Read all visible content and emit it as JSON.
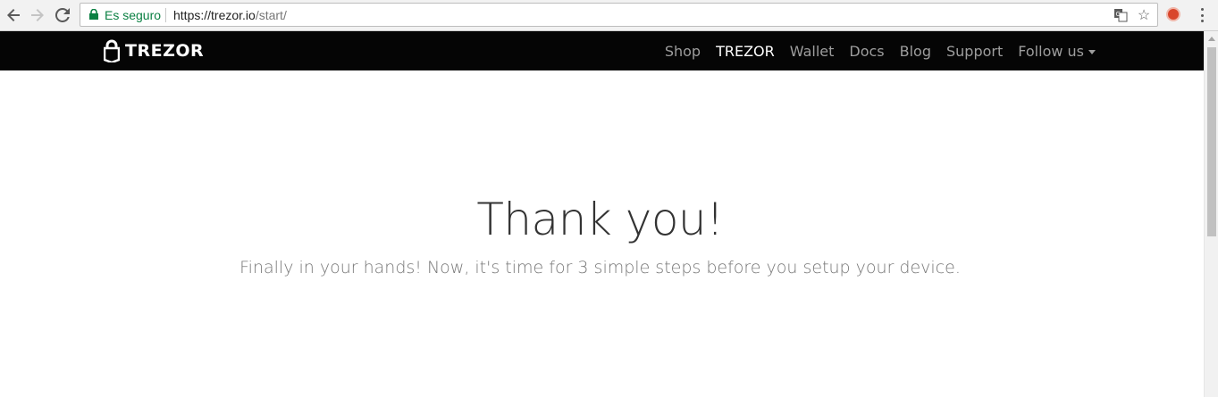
{
  "browser": {
    "security_label": "Es seguro",
    "url_host": "https://trezor.io",
    "url_path": "/start/",
    "icons": [
      "back-icon",
      "forward-icon",
      "reload-icon",
      "lock-icon",
      "translate-icon",
      "star-icon",
      "extension-icon",
      "menu-icon"
    ]
  },
  "site": {
    "logo_text": "TREZOR",
    "nav": [
      {
        "label": "Shop"
      },
      {
        "label": "TREZOR"
      },
      {
        "label": "Wallet"
      },
      {
        "label": "Docs"
      },
      {
        "label": "Blog"
      },
      {
        "label": "Support"
      },
      {
        "label": "Follow us"
      }
    ],
    "active_nav": "TREZOR"
  },
  "main": {
    "headline": "Thank you!",
    "subline": "Finally in your hands! Now, it's time for 3 simple steps before you setup your device."
  },
  "colors": {
    "navbar_bg": "#050505",
    "nav_link": "#9d9d9d",
    "nav_active": "#ffffff",
    "secure_green": "#0b8043"
  }
}
